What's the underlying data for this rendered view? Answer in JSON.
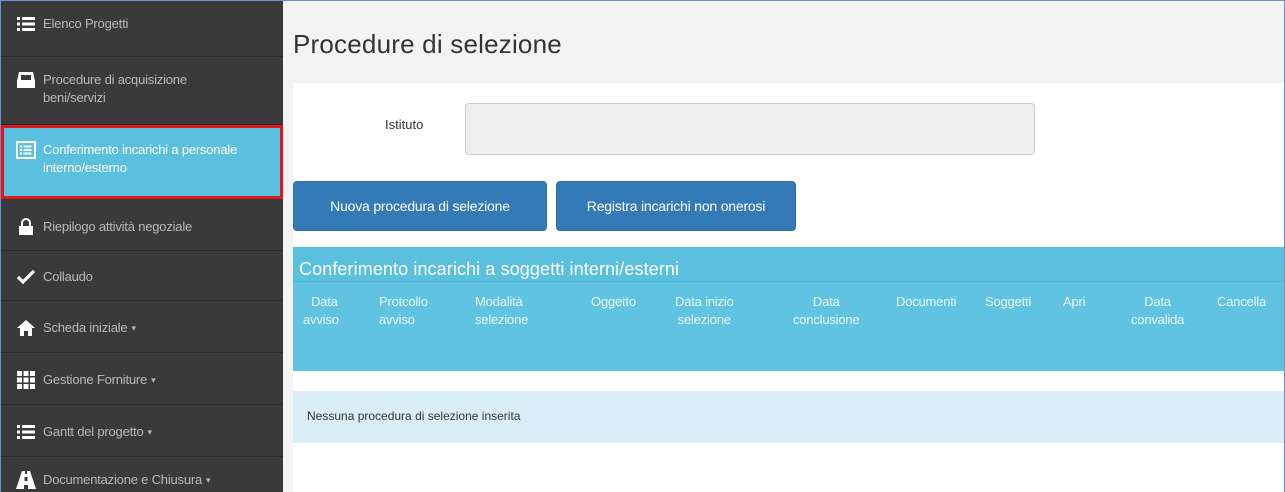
{
  "sidebar": {
    "items": [
      {
        "label": "Elenco Progetti",
        "icon": "list-icon"
      },
      {
        "label": "Procedure di acquisizione beni/servizi",
        "icon": "inbox-icon"
      },
      {
        "label": "Conferimento incarichi a personale interno/esterno",
        "icon": "list-alt-icon"
      },
      {
        "label": "Riepilogo attività negoziale",
        "icon": "lock-icon"
      },
      {
        "label": "Collaudo",
        "icon": "check-icon"
      },
      {
        "label": "Scheda iniziale",
        "icon": "home-icon",
        "caret": "▾"
      },
      {
        "label": "Gestione Forniture",
        "icon": "grid-icon",
        "caret": "▾"
      },
      {
        "label": "Gantt del progetto",
        "icon": "list-icon",
        "caret": "▾"
      },
      {
        "label": "Documentazione e Chiusura",
        "icon": "road-icon",
        "caret": "▾"
      }
    ]
  },
  "main": {
    "title": "Procedure di selezione",
    "istituto_label": "Istituto",
    "istituto_value": "",
    "btn_new": "Nuova procedura di selezione",
    "btn_register": "Registra incarichi non onerosi",
    "table_title": "Conferimento incarichi a soggetti interni/esterni",
    "columns": [
      {
        "line1": "Data",
        "line2": "avviso"
      },
      {
        "line1": "Protcollo",
        "line2": "avviso"
      },
      {
        "line1": "Modalità",
        "line2": "selezione"
      },
      {
        "line1": "Oggetto",
        "line2": ""
      },
      {
        "line1": "Data inizio",
        "line2": "selezione"
      },
      {
        "line1": "Data",
        "line2": "conclusione"
      },
      {
        "line1": "Documenti",
        "line2": ""
      },
      {
        "line1": "Soggetti",
        "line2": ""
      },
      {
        "line1": "Apri",
        "line2": ""
      },
      {
        "line1": "Data",
        "line2": "convalida"
      },
      {
        "line1": "Cancella",
        "line2": ""
      }
    ],
    "empty_message": "Nessuna procedura di selezione inserita"
  },
  "colors": {
    "sidebar_bg": "#3a3a3a",
    "active_bg": "#5bc0de",
    "highlight_border": "#e0181b",
    "primary_button": "#337ab7",
    "table_header": "#5bc0de",
    "empty_row": "#d9edf7"
  }
}
